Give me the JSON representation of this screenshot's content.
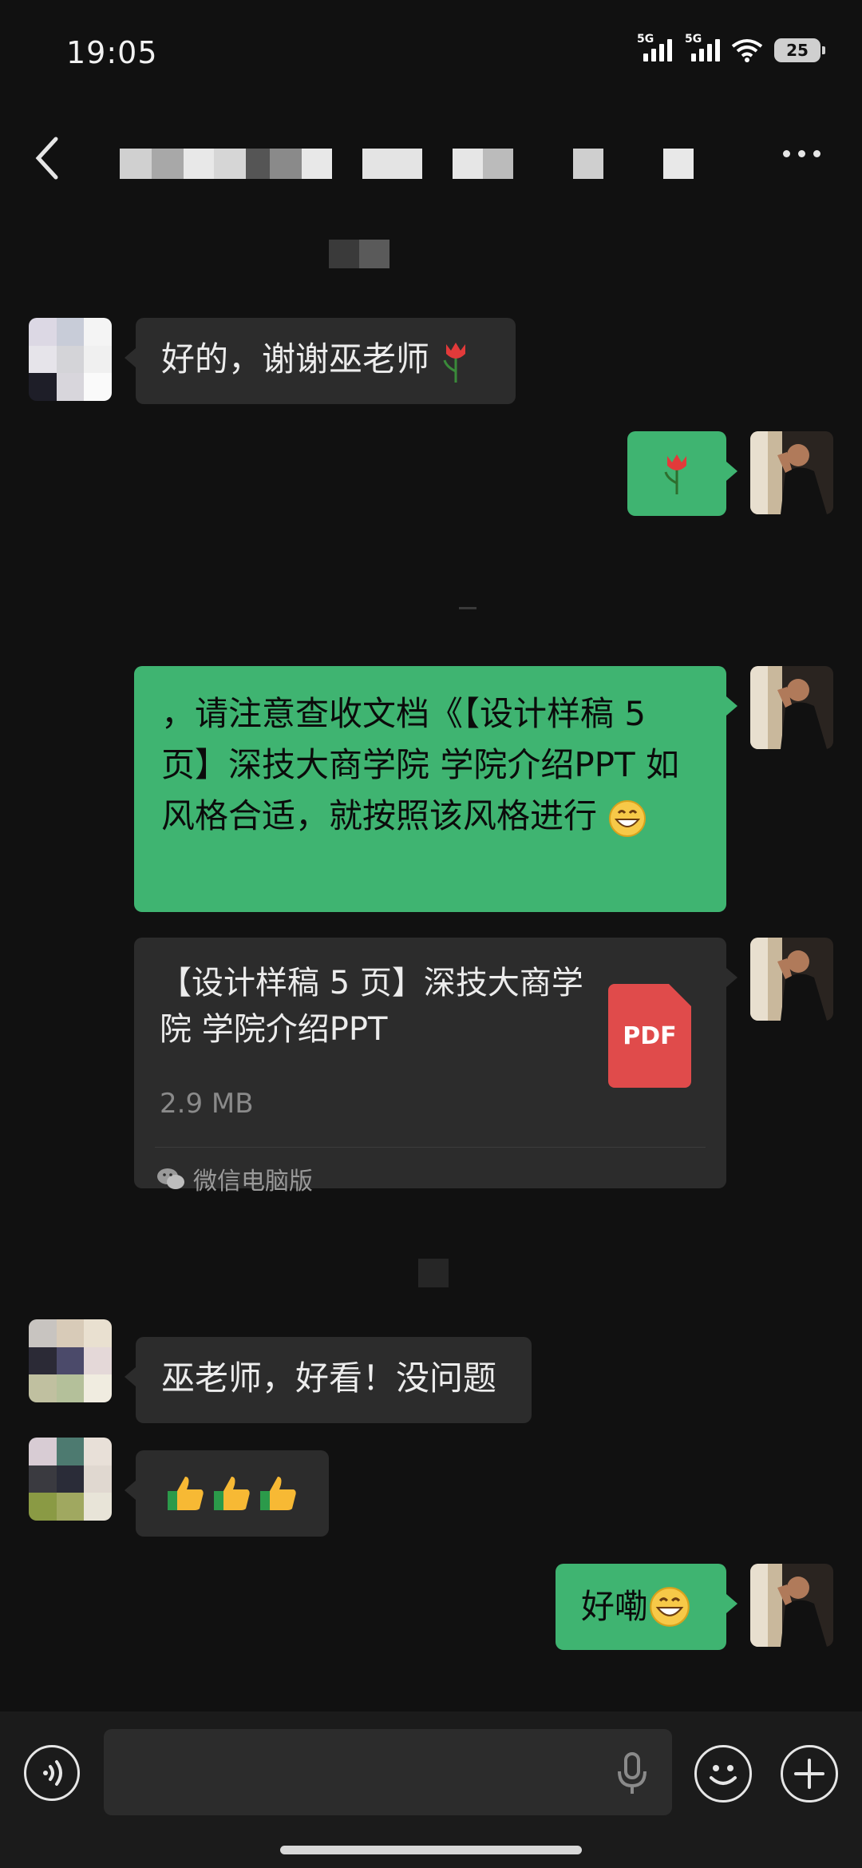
{
  "status_bar": {
    "time": "19:05",
    "signal1_label": "5G",
    "signal2_label": "5G",
    "battery": "25",
    "wifi_icon": "wifi-icon"
  },
  "header": {
    "title": "",
    "back_icon": "chevron-left-icon",
    "more_icon": "more-icon"
  },
  "messages": [
    {
      "side": "in",
      "text": "好的，谢谢巫老师",
      "emoji": "tulip"
    },
    {
      "side": "out",
      "text": "",
      "emoji": "tulip"
    },
    {
      "side": "out",
      "text": "，请注意查收文档《【设计样稿 5 页】深技大商学院 学院介绍PPT 如风格合适，就按照该风格进行"
    },
    {
      "side": "out",
      "type": "file",
      "file_title": "【设计样稿 5 页】深技大商学院 学院介绍PPT",
      "file_size": "2.9 MB",
      "file_type": "PDF",
      "source": "微信电脑版"
    },
    {
      "side": "in",
      "text": "巫老师，好看！没问题"
    },
    {
      "side": "in",
      "text": "",
      "emoji": "thumbs-up-x3"
    },
    {
      "side": "out",
      "text": "好嘞",
      "emoji": "grin"
    }
  ],
  "input_bar": {
    "placeholder": "",
    "voice_icon": "voice-icon",
    "mic_icon": "mic-icon",
    "emoji_icon": "emoji-icon",
    "plus_icon": "plus-icon"
  },
  "colors": {
    "background": "#111111",
    "bubble_in": "#2c2c2c",
    "bubble_out": "#3fb471",
    "pdf_red": "#e04b4b"
  }
}
